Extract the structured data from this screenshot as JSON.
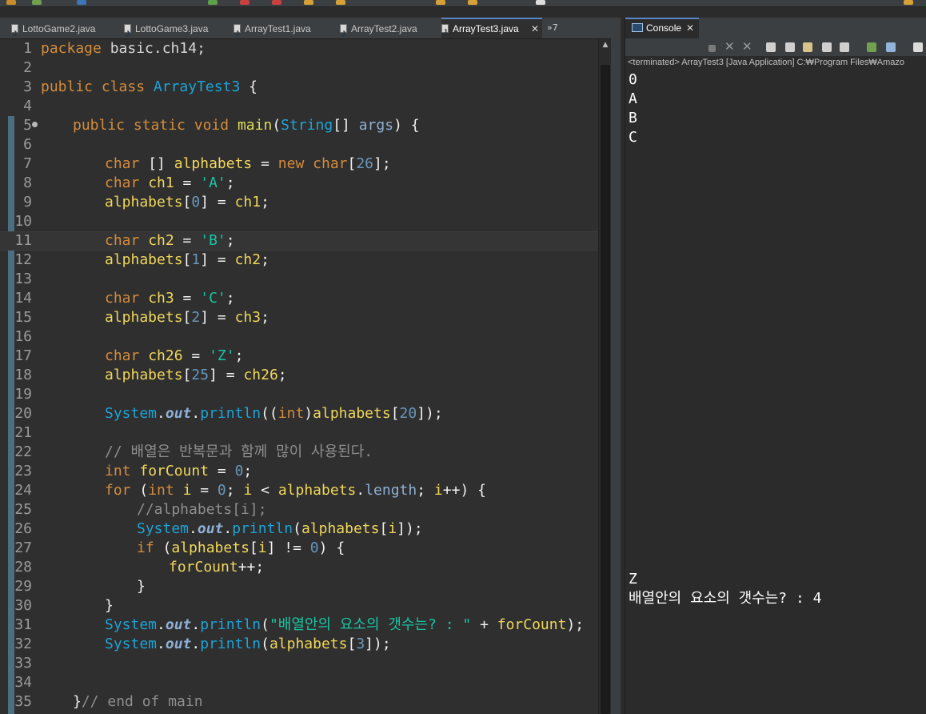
{
  "editor": {
    "tabs": [
      {
        "label": "LottoGame2.java"
      },
      {
        "label": "LottoGame3.java"
      },
      {
        "label": "ArrayTest1.java"
      },
      {
        "label": "ArrayTest2.java"
      },
      {
        "label": "ArrayTest3.java",
        "close": "✕"
      }
    ],
    "overflow_label": "»7",
    "line_numbers": [
      "1",
      "2",
      "3",
      "4",
      "5",
      "6",
      "7",
      "8",
      "9",
      "10",
      "11",
      "12",
      "13",
      "14",
      "15",
      "16",
      "17",
      "18",
      "19",
      "20",
      "21",
      "22",
      "23",
      "24",
      "25",
      "26",
      "27",
      "28",
      "29",
      "30",
      "31",
      "32",
      "33",
      "34",
      "35"
    ],
    "code": {
      "l1": [
        "package",
        " basic.ch14;"
      ],
      "l3": [
        "public",
        " ",
        "class",
        " ",
        "ArrayTest3",
        " {"
      ],
      "l5": [
        "public",
        " ",
        "static",
        " ",
        "void",
        " ",
        "main",
        "(",
        "String",
        "[] ",
        "args",
        ") {"
      ],
      "l7": [
        "char",
        " [] ",
        "alphabets",
        " = ",
        "new",
        " ",
        "char",
        "[",
        "26",
        "];"
      ],
      "l8": [
        "char",
        " ",
        "ch1",
        " = ",
        "'A'",
        ";"
      ],
      "l9": [
        "alphabets",
        "[",
        "0",
        "] = ",
        "ch1",
        ";"
      ],
      "l11": [
        "char",
        " ",
        "ch2",
        " = ",
        "'B'",
        ";"
      ],
      "l12": [
        "alphabets",
        "[",
        "1",
        "] = ",
        "ch2",
        ";"
      ],
      "l14": [
        "char",
        " ",
        "ch3",
        " = ",
        "'C'",
        ";"
      ],
      "l15": [
        "alphabets",
        "[",
        "2",
        "] = ",
        "ch3",
        ";"
      ],
      "l17": [
        "char",
        " ",
        "ch26",
        " = ",
        "'Z'",
        ";"
      ],
      "l18": [
        "alphabets",
        "[",
        "25",
        "] = ",
        "ch26",
        ";"
      ],
      "l20": [
        "System",
        ".",
        "out",
        ".",
        "println",
        "((",
        "int",
        ")",
        "alphabets",
        "[",
        "20",
        "]);"
      ],
      "l22": "// 배열은 반복문과 함께 많이 사용된다.",
      "l23": [
        "int",
        " ",
        "forCount",
        " = ",
        "0",
        ";"
      ],
      "l24": [
        "for",
        " (",
        "int",
        " ",
        "i",
        " = ",
        "0",
        "; ",
        "i",
        " < ",
        "alphabets",
        ".",
        "length",
        "; ",
        "i",
        "++) {"
      ],
      "l25": "//alphabets[i];",
      "l26": [
        "System",
        ".",
        "out",
        ".",
        "println",
        "(",
        "alphabets",
        "[",
        "i",
        "]);"
      ],
      "l27": [
        "if",
        " (",
        "alphabets",
        "[",
        "i",
        "] != ",
        "0",
        ") {"
      ],
      "l28": [
        "forCount",
        "++;"
      ],
      "l29": "}",
      "l30": "}",
      "l31": [
        "System",
        ".",
        "out",
        ".",
        "println",
        "(",
        "\"배열안의 요소의 갯수는? : \"",
        " + ",
        "forCount",
        ");"
      ],
      "l32": [
        "System",
        ".",
        "out",
        ".",
        "println",
        "(",
        "alphabets",
        "[",
        "3",
        "]);"
      ],
      "l35": [
        "}",
        "// end of main"
      ]
    }
  },
  "console": {
    "tab_label": "Console",
    "tab_close": "✕",
    "status": "<terminated> ArrayTest3 [Java Application] C:₩Program Files₩Amazo",
    "output_top": [
      "0",
      "A",
      "B",
      "C"
    ],
    "output_bottom": [
      "Z",
      "배열안의 요소의 갯수는? : 4"
    ]
  }
}
